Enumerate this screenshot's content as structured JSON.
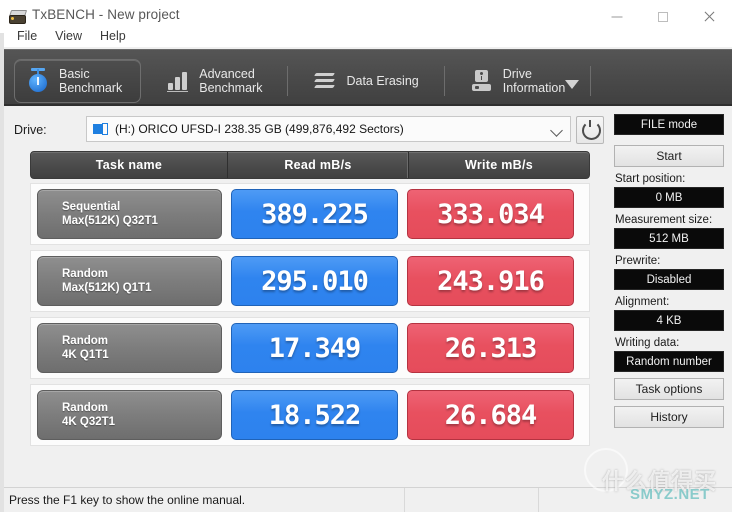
{
  "window": {
    "title": "TxBENCH - New project",
    "app_icon": "txbench-logo-icon",
    "controls": {
      "minimize": "minimize-icon",
      "maximize": "maximize-icon",
      "close": "close-icon"
    }
  },
  "menubar": {
    "items": [
      "File",
      "View",
      "Help"
    ]
  },
  "tabs": {
    "items": [
      {
        "label_line1": "Basic",
        "label_line2": "Benchmark",
        "icon": "stopwatch-icon",
        "active": true
      },
      {
        "label_line1": "Advanced",
        "label_line2": "Benchmark",
        "icon": "bar-chart-icon",
        "active": false
      },
      {
        "label_line1": "Data Erasing",
        "label_line2": "",
        "icon": "zigzag-erase-icon",
        "active": false
      },
      {
        "label_line1": "Drive",
        "label_line2": "Information",
        "icon": "drive-icon",
        "active": false
      }
    ],
    "overflow_icon": "chevron-down-icon"
  },
  "drive": {
    "label": "Drive:",
    "selected": "(H:) ORICO UFSD-I  238.35 GB (499,876,492 Sectors)",
    "drive_icon": "disk-drive-icon",
    "dropdown_icon": "chevron-down-icon",
    "refresh_icon": "refresh-icon"
  },
  "results": {
    "headers": [
      "Task name",
      "Read mB/s",
      "Write mB/s"
    ],
    "rows": [
      {
        "name_line1": "Sequential",
        "name_line2": "Max(512K) Q32T1",
        "read": "389.225",
        "write": "333.034"
      },
      {
        "name_line1": "Random",
        "name_line2": "Max(512K) Q1T1",
        "read": "295.010",
        "write": "243.916"
      },
      {
        "name_line1": "Random",
        "name_line2": "4K Q1T1",
        "read": "17.349",
        "write": "26.313"
      },
      {
        "name_line1": "Random",
        "name_line2": "4K Q32T1",
        "read": "18.522",
        "write": "26.684"
      }
    ],
    "read_color": "#2d82ee",
    "write_color": "#e8505f"
  },
  "panel": {
    "mode": "FILE mode",
    "start_button": "Start",
    "start_position_label": "Start position:",
    "start_position_value": "0 MB",
    "measurement_size_label": "Measurement size:",
    "measurement_size_value": "512 MB",
    "prewrite_label": "Prewrite:",
    "prewrite_value": "Disabled",
    "alignment_label": "Alignment:",
    "alignment_value": "4 KB",
    "writing_data_label": "Writing data:",
    "writing_data_value": "Random number",
    "task_options_button": "Task options",
    "history_button": "History"
  },
  "statusbar": {
    "text": "Press the F1 key to show the online manual."
  },
  "watermark": {
    "cn": "什么值得买",
    "en": "SMYZ.NET"
  }
}
